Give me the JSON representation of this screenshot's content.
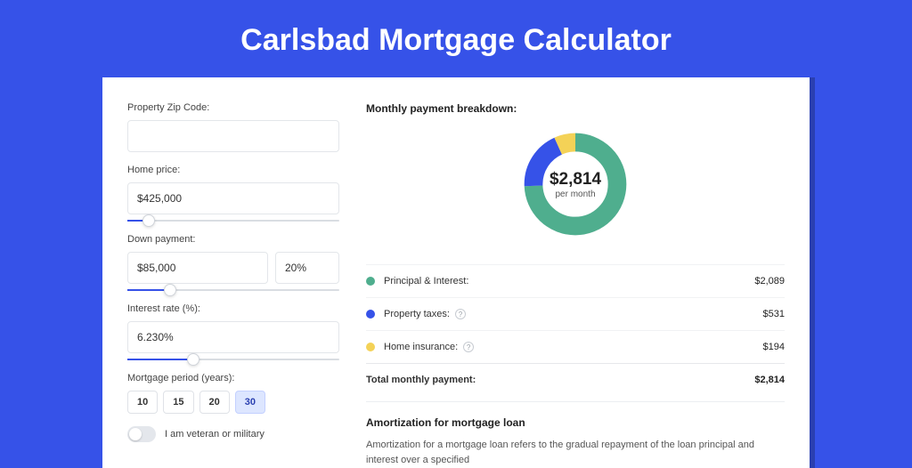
{
  "title": "Carlsbad Mortgage Calculator",
  "colors": {
    "green": "#4fae8e",
    "blue": "#3652e8",
    "yellow": "#f4d257"
  },
  "form": {
    "zip_label": "Property Zip Code:",
    "zip_value": "",
    "home_price_label": "Home price:",
    "home_price_value": "$425,000",
    "home_price_slider_pct": 10,
    "down_label": "Down payment:",
    "down_amount": "$85,000",
    "down_pct": "20%",
    "down_slider_pct": 20,
    "rate_label": "Interest rate (%):",
    "rate_value": "6.230%",
    "rate_slider_pct": 31,
    "period_label": "Mortgage period (years):",
    "periods": [
      "10",
      "15",
      "20",
      "30"
    ],
    "period_active_index": 3,
    "veteran_label": "I am veteran or military"
  },
  "breakdown": {
    "heading": "Monthly payment breakdown:",
    "center_amount": "$2,814",
    "center_sub": "per month",
    "principal_label": "Principal & Interest:",
    "principal_value": "$2,089",
    "taxes_label": "Property taxes:",
    "taxes_value": "$531",
    "insurance_label": "Home insurance:",
    "insurance_value": "$194",
    "total_label": "Total monthly payment:",
    "total_value": "$2,814"
  },
  "chart_data": {
    "type": "pie",
    "title": "Monthly payment breakdown",
    "series": [
      {
        "name": "Principal & Interest",
        "value": 2089,
        "color": "#4fae8e"
      },
      {
        "name": "Property taxes",
        "value": 531,
        "color": "#3652e8"
      },
      {
        "name": "Home insurance",
        "value": 194,
        "color": "#f4d257"
      }
    ],
    "total": 2814
  },
  "amortization": {
    "heading": "Amortization for mortgage loan",
    "text": "Amortization for a mortgage loan refers to the gradual repayment of the loan principal and interest over a specified"
  }
}
